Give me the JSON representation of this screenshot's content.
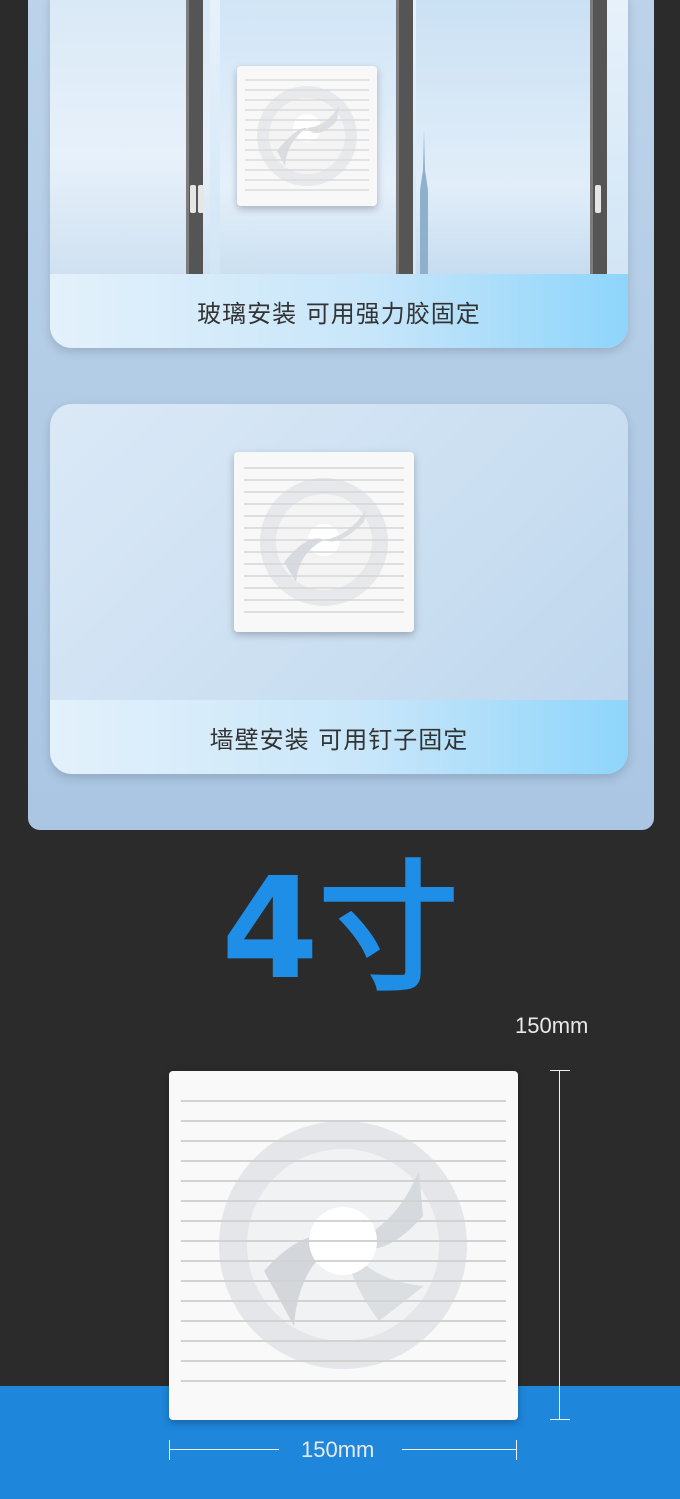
{
  "cards": [
    {
      "caption": "玻璃安装 可用强力胶固定"
    },
    {
      "caption": "墙壁安装 可用钉子固定"
    }
  ],
  "size": {
    "title": "4寸",
    "height_label": "150mm",
    "width_label": "150mm"
  },
  "colors": {
    "accent": "#1e8ee6",
    "band": "#1e86db",
    "panel": "#aac6e3"
  }
}
